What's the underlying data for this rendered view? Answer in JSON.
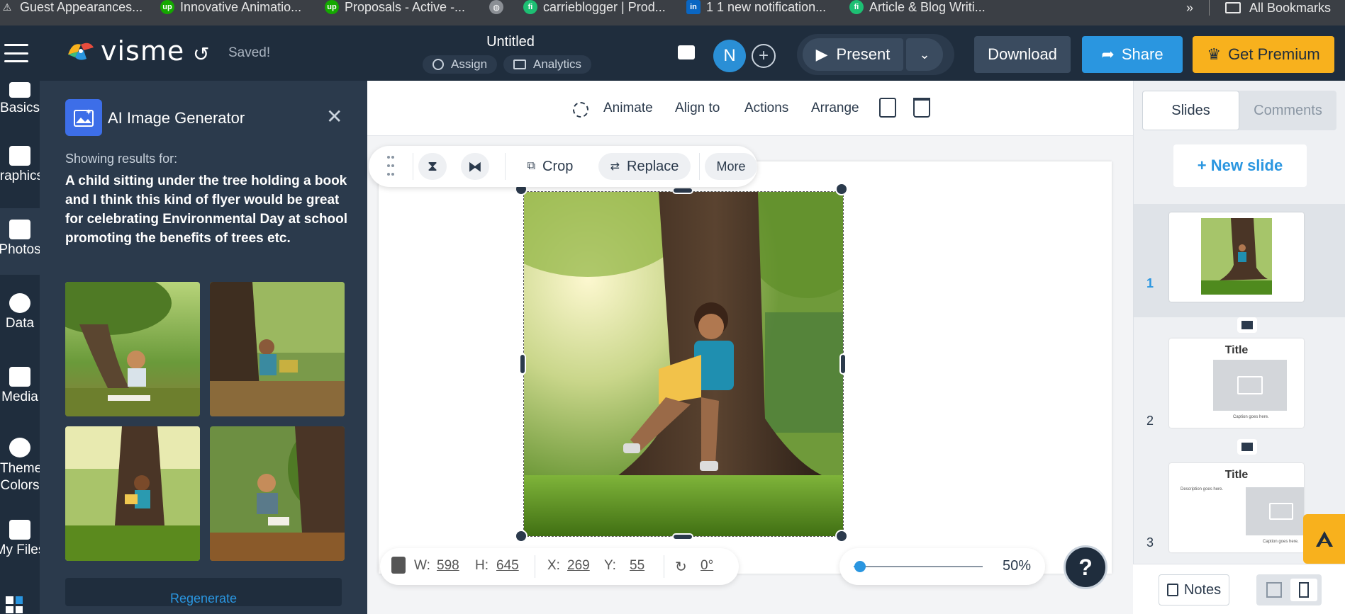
{
  "bookmarks": {
    "items": [
      {
        "label": "Guest Appearances...",
        "icon": "warning-icon"
      },
      {
        "label": "Innovative Animatio...",
        "icon": "upwork-icon"
      },
      {
        "label": "Proposals - Active -...",
        "icon": "upwork-icon"
      },
      {
        "label": "",
        "icon": "globe-icon"
      },
      {
        "label": "carrieblogger | Prod...",
        "icon": "fiverr-icon"
      },
      {
        "label": "1 1 new notification...",
        "icon": "linkedin-icon"
      },
      {
        "label": "Article & Blog Writi...",
        "icon": "fiverr-icon"
      }
    ],
    "more": "»",
    "all_bookmarks": "All Bookmarks"
  },
  "topbar": {
    "logo": "visme",
    "saved": "Saved!",
    "doc_title": "Untitled",
    "assign": "Assign",
    "analytics": "Analytics",
    "avatar_initial": "N",
    "present": "Present",
    "download": "Download",
    "share": "Share",
    "premium": "Get Premium"
  },
  "rail": {
    "items": [
      {
        "label": "Basics"
      },
      {
        "label": "Graphics"
      },
      {
        "label": "Photos"
      },
      {
        "label": "Data"
      },
      {
        "label": "Media"
      },
      {
        "label": "Theme Colors"
      },
      {
        "label": "My Files"
      }
    ]
  },
  "panel": {
    "title": "AI Image Generator",
    "showing": "Showing results for:",
    "prompt": "A child sitting under the tree holding a book and I think this kind of flyer would be great for celebrating Environmental Day at school promoting the benefits of trees etc.",
    "regenerate": "Regenerate"
  },
  "toolbar": {
    "animate": "Animate",
    "align": "Align to",
    "actions": "Actions",
    "arrange": "Arrange"
  },
  "float_bar": {
    "crop": "Crop",
    "replace": "Replace",
    "more": "More"
  },
  "dims": {
    "w_label": "W:",
    "w": "598",
    "h_label": "H:",
    "h": "645",
    "x_label": "X:",
    "x": "269",
    "y_label": "Y:",
    "y": "55",
    "rotation": "0°"
  },
  "zoom": {
    "level": "50%",
    "fraction": 0.05
  },
  "help": "?",
  "right_panel": {
    "tab_slides": "Slides",
    "tab_comments": "Comments",
    "new_slide": "+ New slide",
    "slides": [
      {
        "num": "1"
      },
      {
        "num": "2",
        "title": "Title",
        "caption": "Caption goes here."
      },
      {
        "num": "3",
        "title": "Title",
        "description": "Description goes here.",
        "caption": "Caption goes here."
      }
    ],
    "notes": "Notes"
  },
  "colors": {
    "dark": "#1f2d3d",
    "panel": "#2b3a4c",
    "accent_blue": "#2a96e0",
    "premium": "#f8b11d"
  }
}
